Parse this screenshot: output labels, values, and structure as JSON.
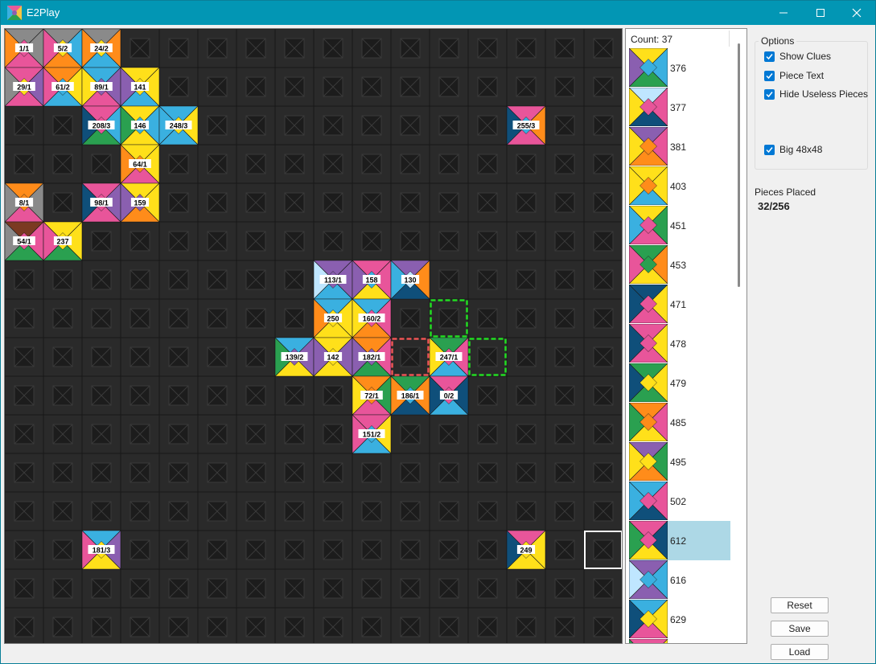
{
  "window": {
    "title": "E2Play",
    "icon": "puzzle-app-icon"
  },
  "colors": {
    "board_cell": "#2a2a2a",
    "board_grid": "#181818",
    "hint_valid": "#22dd22",
    "hint_invalid": "#ee5555",
    "cursor": "#ffffff",
    "selected_row": "#add8e6",
    "checkbox": "#0078d4",
    "tile_palette": [
      "#ff8c1a",
      "#3ab0e0",
      "#ffe01a",
      "#e8559a",
      "#2aa050",
      "#0f4f7a",
      "#8a5fb0",
      "#7b3a22",
      "#8a8a8a",
      "#bfe6ff"
    ]
  },
  "board": {
    "rows": 16,
    "cols": 16,
    "placed": [
      {
        "row": 0,
        "col": 0,
        "label": "1/1",
        "c": [
          8,
          8,
          3,
          0
        ],
        "m": 3
      },
      {
        "row": 0,
        "col": 1,
        "label": "5/2",
        "c": [
          8,
          1,
          0,
          3
        ],
        "m": 2
      },
      {
        "row": 0,
        "col": 2,
        "label": "24/2",
        "c": [
          8,
          0,
          1,
          0
        ],
        "m": 2
      },
      {
        "row": 1,
        "col": 0,
        "label": "29/1",
        "c": [
          3,
          6,
          3,
          8
        ],
        "m": 2
      },
      {
        "row": 1,
        "col": 1,
        "label": "61/2",
        "c": [
          0,
          2,
          1,
          3
        ],
        "m": 1
      },
      {
        "row": 1,
        "col": 2,
        "label": "89/1",
        "c": [
          1,
          6,
          3,
          2
        ],
        "m": 6
      },
      {
        "row": 1,
        "col": 3,
        "label": "141",
        "c": [
          2,
          2,
          1,
          6
        ],
        "m": 2
      },
      {
        "row": 2,
        "col": 2,
        "label": "208/3",
        "c": [
          3,
          1,
          4,
          5
        ],
        "m": 3
      },
      {
        "row": 2,
        "col": 3,
        "label": "146",
        "c": [
          2,
          1,
          2,
          4
        ],
        "m": 1
      },
      {
        "row": 2,
        "col": 4,
        "label": "248/3",
        "c": [
          1,
          2,
          1,
          1
        ],
        "m": 2
      },
      {
        "row": 2,
        "col": 13,
        "label": "255/3",
        "c": [
          3,
          0,
          3,
          5
        ],
        "m": 1
      },
      {
        "row": 3,
        "col": 3,
        "label": "64/1",
        "c": [
          2,
          2,
          3,
          0
        ],
        "m": 0
      },
      {
        "row": 4,
        "col": 0,
        "label": "8/1",
        "c": [
          0,
          8,
          3,
          8
        ],
        "m": 0
      },
      {
        "row": 4,
        "col": 2,
        "label": "98/1",
        "c": [
          3,
          6,
          3,
          5
        ],
        "m": 3
      },
      {
        "row": 4,
        "col": 3,
        "label": "159",
        "c": [
          2,
          2,
          0,
          6
        ],
        "m": 6
      },
      {
        "row": 5,
        "col": 0,
        "label": "54/1",
        "c": [
          7,
          3,
          4,
          8
        ],
        "m": 3
      },
      {
        "row": 5,
        "col": 1,
        "label": "237",
        "c": [
          2,
          2,
          4,
          3
        ],
        "m": 2
      },
      {
        "row": 6,
        "col": 8,
        "label": "113/1",
        "c": [
          6,
          6,
          1,
          9
        ],
        "m": 6
      },
      {
        "row": 6,
        "col": 9,
        "label": "158",
        "c": [
          3,
          3,
          2,
          6
        ],
        "m": 1
      },
      {
        "row": 6,
        "col": 10,
        "label": "130",
        "c": [
          6,
          0,
          5,
          1
        ],
        "m": 9
      },
      {
        "row": 7,
        "col": 8,
        "label": "250",
        "c": [
          1,
          2,
          2,
          0
        ],
        "m": 2
      },
      {
        "row": 7,
        "col": 9,
        "label": "160/2",
        "c": [
          1,
          3,
          0,
          2
        ],
        "m": 3
      },
      {
        "row": 8,
        "col": 7,
        "label": "139/2",
        "c": [
          1,
          6,
          2,
          4
        ],
        "m": 6
      },
      {
        "row": 8,
        "col": 8,
        "label": "142",
        "c": [
          2,
          6,
          2,
          6
        ],
        "m": 2
      },
      {
        "row": 8,
        "col": 9,
        "label": "182/1",
        "c": [
          0,
          3,
          4,
          6
        ],
        "m": 6
      },
      {
        "row": 8,
        "col": 11,
        "label": "247/1",
        "c": [
          4,
          3,
          1,
          2
        ],
        "m": 3
      },
      {
        "row": 9,
        "col": 9,
        "label": "72/1",
        "c": [
          0,
          4,
          3,
          2
        ],
        "m": 0
      },
      {
        "row": 9,
        "col": 10,
        "label": "186/1",
        "c": [
          4,
          0,
          5,
          0
        ],
        "m": 1
      },
      {
        "row": 9,
        "col": 11,
        "label": "0/2",
        "c": [
          3,
          5,
          1,
          5
        ],
        "m": 3
      },
      {
        "row": 10,
        "col": 9,
        "label": "151/2",
        "c": [
          3,
          2,
          1,
          3
        ],
        "m": 1
      },
      {
        "row": 13,
        "col": 2,
        "label": "181/3",
        "c": [
          1,
          6,
          2,
          3
        ],
        "m": 2
      },
      {
        "row": 13,
        "col": 13,
        "label": "249",
        "c": [
          3,
          2,
          2,
          5
        ],
        "m": 2
      }
    ],
    "hints_valid": [
      [
        7,
        11
      ],
      [
        8,
        12
      ]
    ],
    "hints_invalid": [
      [
        8,
        10
      ]
    ],
    "cursor": [
      13,
      15
    ]
  },
  "piece_list": {
    "count_label": "Count: 37",
    "items": [
      {
        "id": "376",
        "c": [
          2,
          1,
          4,
          6
        ],
        "m": 1,
        "selected": false
      },
      {
        "id": "377",
        "c": [
          9,
          3,
          5,
          2
        ],
        "m": 3,
        "selected": false
      },
      {
        "id": "381",
        "c": [
          6,
          3,
          0,
          2
        ],
        "m": 0,
        "selected": false
      },
      {
        "id": "403",
        "c": [
          2,
          2,
          1,
          2
        ],
        "m": 0,
        "selected": false
      },
      {
        "id": "451",
        "c": [
          2,
          4,
          3,
          1
        ],
        "m": 3,
        "selected": false
      },
      {
        "id": "453",
        "c": [
          4,
          0,
          2,
          3
        ],
        "m": 4,
        "selected": false
      },
      {
        "id": "471",
        "c": [
          5,
          2,
          3,
          5
        ],
        "m": 3,
        "selected": false
      },
      {
        "id": "478",
        "c": [
          3,
          2,
          3,
          5
        ],
        "m": 3,
        "selected": false
      },
      {
        "id": "479",
        "c": [
          4,
          2,
          4,
          5
        ],
        "m": 2,
        "selected": false
      },
      {
        "id": "485",
        "c": [
          0,
          3,
          2,
          4
        ],
        "m": 0,
        "selected": false
      },
      {
        "id": "495",
        "c": [
          6,
          4,
          0,
          2
        ],
        "m": 2,
        "selected": false
      },
      {
        "id": "502",
        "c": [
          1,
          3,
          5,
          1
        ],
        "m": 3,
        "selected": false
      },
      {
        "id": "612",
        "c": [
          3,
          5,
          2,
          4
        ],
        "m": 3,
        "selected": true
      },
      {
        "id": "616",
        "c": [
          6,
          1,
          6,
          9
        ],
        "m": 1,
        "selected": false
      },
      {
        "id": "629",
        "c": [
          1,
          2,
          3,
          5
        ],
        "m": 2,
        "selected": false
      },
      {
        "id": "",
        "c": [
          3,
          2,
          1,
          4
        ],
        "m": 2,
        "selected": false
      }
    ]
  },
  "options": {
    "group_label": "Options",
    "show_clues": {
      "label": "Show Clues",
      "checked": true
    },
    "piece_text": {
      "label": "Piece Text",
      "checked": true
    },
    "hide_useless": {
      "label": "Hide Useless Pieces",
      "checked": true
    },
    "big": {
      "label": "Big 48x48",
      "checked": true
    }
  },
  "status": {
    "pieces_placed_label": "Pieces Placed",
    "pieces_placed_value": "32/256"
  },
  "buttons": {
    "reset": "Reset",
    "save": "Save",
    "load": "Load"
  }
}
